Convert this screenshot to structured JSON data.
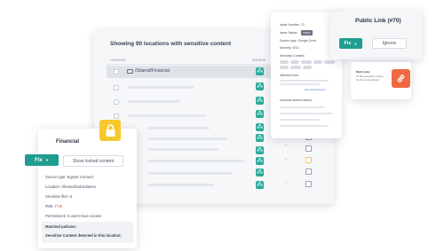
{
  "main_panel": {
    "title": "Showing 90 locations with sensitive content",
    "col_location": "LOCATION",
    "col_source": "SOURCE",
    "first_row_path": "/Shared/Financial"
  },
  "issue_panel": {
    "issue_number": "Issue Number: 70",
    "issue_status_label": "Issue Status:",
    "issue_status_badge": "OPEN",
    "source_type": "Source type: Google Drive",
    "severity": "Severity: 8/10",
    "sensitive_content": "Sensitive Content:",
    "affected_user": "Affected User:",
    "unusual_history": "Unusual access history:",
    "link": "Show all permissions"
  },
  "public_link": {
    "title": "Public Link (#70)",
    "fix_label": "Fix",
    "ignore_label": "Ignore"
  },
  "tooltip": {
    "heading": "Multi-Links",
    "text": "As files are public, a link to the file can be deleted."
  },
  "details": {
    "title": "Financial",
    "fix_label": "Fix",
    "show_locked_label": "Show locked content",
    "source_type": "Source type: Egnyte Connect",
    "location": "Location: /Shared/Subsidiaries",
    "sensitive_files": "Sensitive files: 5",
    "risk_label": "Risk:",
    "risk_value": "7 / 8",
    "permissions": "Permissions: 5 users have access",
    "matched_policies": "Matched policies:",
    "sensitive_detected": "Sensitive Content detected in this location:"
  },
  "colors": {
    "accent": "#1f9e8f",
    "lock_badge": "#f5c82d",
    "link_badge": "#ee6a43",
    "risk": "#e0524d"
  },
  "icons": {
    "folder": "folder-icon",
    "tree": "tree-icon",
    "lock": "lock-icon",
    "link": "link-icon"
  }
}
